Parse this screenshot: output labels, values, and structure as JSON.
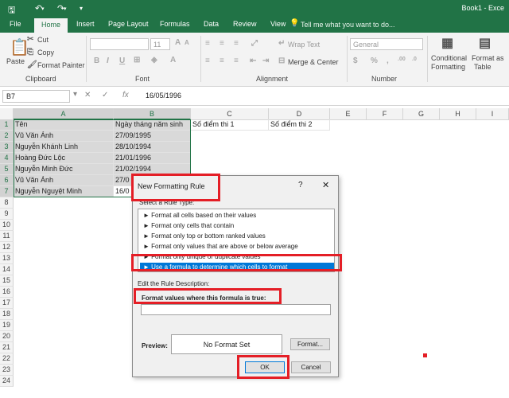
{
  "titlebar": {
    "save_icon": "save-icon",
    "undo_icon": "undo-icon",
    "redo_icon": "redo-icon",
    "customize_icon": "dropdown-icon",
    "book_title": "Book1 - Exce"
  },
  "tabs": [
    "File",
    "Home",
    "Insert",
    "Page Layout",
    "Formulas",
    "Data",
    "Review",
    "View"
  ],
  "tellme": "Tell me what you want to do...",
  "ribbon": {
    "paste": "Paste",
    "cut": "Cut",
    "copy": "Copy",
    "format_painter": "Format Painter",
    "clipboard": "Clipboard",
    "font_name": "",
    "font_size": "11",
    "font_label": "Font",
    "wrap_text": "Wrap Text",
    "merge_center": "Merge & Center",
    "alignment_label": "Alignment",
    "number_format": "General",
    "number_label": "Number",
    "cond_format_1": "Conditional",
    "cond_format_2": "Formatting",
    "format_as_1": "Format as",
    "format_as_2": "Table",
    "bold": "B",
    "italic": "I",
    "underline": "U"
  },
  "formula_bar": {
    "name_box": "B7",
    "cancel": "✕",
    "enter": "✓",
    "fx": "fx",
    "value": "16/05/1996"
  },
  "columns": [
    "A",
    "B",
    "C",
    "D",
    "E",
    "F",
    "G",
    "H",
    "I"
  ],
  "rows": [
    "1",
    "2",
    "3",
    "4",
    "5",
    "6",
    "7",
    "8",
    "9",
    "10",
    "11",
    "12",
    "13",
    "14",
    "15",
    "16",
    "17",
    "18",
    "19",
    "20",
    "21",
    "22",
    "23",
    "24"
  ],
  "cells": {
    "A1": "Tên",
    "B1": "Ngày tháng năm sinh",
    "C1": "Số điểm thi 1",
    "D1": "Số điểm thi 2",
    "A2": "Vũ Văn Ánh",
    "B2": "27/09/1995",
    "A3": "Nguyễn Khánh Linh",
    "B3": "28/10/1994",
    "A4": "Hoàng Đức Lộc",
    "B4": "21/01/1996",
    "A5": "Nguyễn Minh Đức",
    "B5": "21/02/1994",
    "A6": "Vũ Văn Ánh",
    "B6": "27/0",
    "A7": "Nguyễn Nguyệt Minh",
    "B7": "16/0"
  },
  "dialog": {
    "title": "New Formatting Rule",
    "help": "?",
    "close": "✕",
    "select_rule_type": "Select a Rule Type:",
    "rule_types": [
      "► Format all cells based on their values",
      "► Format only cells that contain",
      "► Format only top or bottom ranked values",
      "► Format only values that are above or below average",
      "► Format only unique or duplicate values",
      "► Use a formula to determine which cells to format"
    ],
    "edit_description": "Edit the Rule Description:",
    "formula_label": "Format values where this formula is true:",
    "formula_value": "",
    "preview_label": "Preview:",
    "preview_text": "No Format Set",
    "format_button": "Format...",
    "ok": "OK",
    "cancel": "Cancel"
  },
  "colors": {
    "excel_green": "#217346",
    "highlight_red": "#e41e26",
    "selection_blue": "#0078d7"
  }
}
